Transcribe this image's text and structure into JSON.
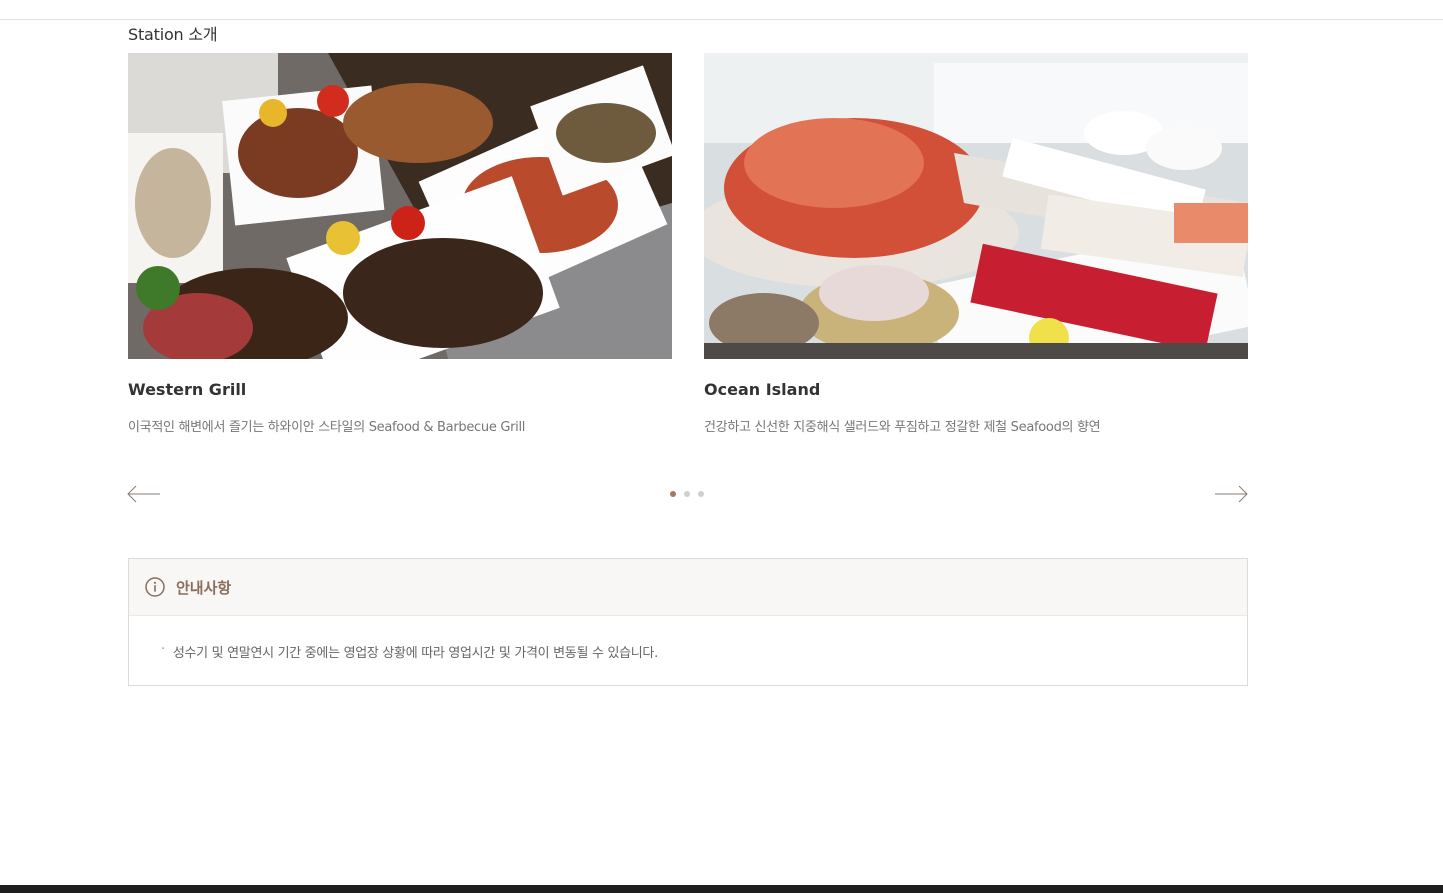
{
  "section": {
    "title": "Station 소개"
  },
  "slides": [
    {
      "name": "Western Grill",
      "description": "이국적인 해변에서 즐기는 하와이안 스타일의 Seafood & Barbecue Grill",
      "image": "grilled meat and seafood buffet"
    },
    {
      "name": "Ocean Island",
      "description": "건강하고 신선한 지중해식 샐러드와 푸짐하고 정갈한 제철 Seafood의 향연",
      "image": "crab and sashimi seafood buffet"
    }
  ],
  "carousel": {
    "prev_icon": "arrow-left-icon",
    "next_icon": "arrow-right-icon",
    "page_count": 3,
    "current_page": 1,
    "active_color": "#9c7b64"
  },
  "notice": {
    "title": "안내사항",
    "icon": "info-icon",
    "items": [
      "성수기 및 연말연시 기간 중에는 영업장 상황에 따라 영업시간 및 가격이 변동될 수 있습니다."
    ]
  },
  "colors": {
    "accent": "#8a6e5b",
    "footer": "#1e1e1e"
  }
}
